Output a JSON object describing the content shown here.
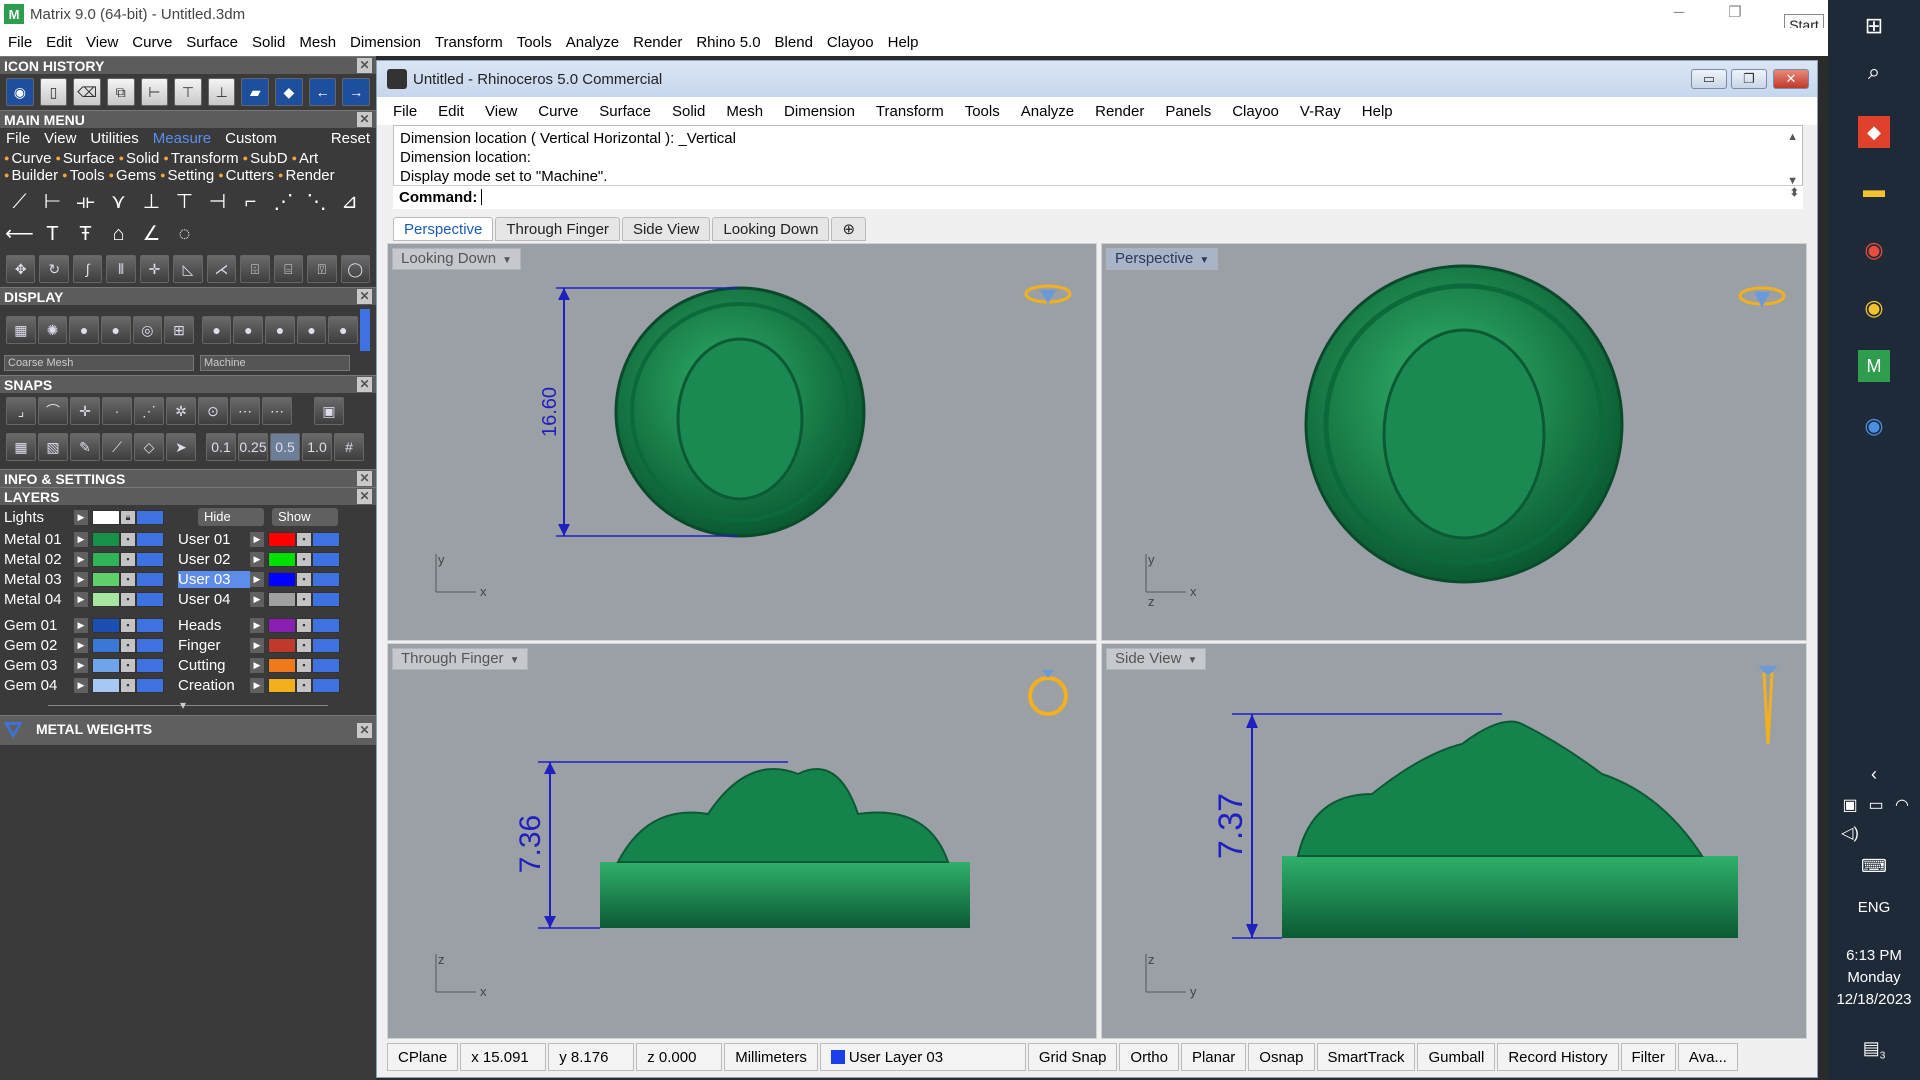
{
  "window": {
    "title": "Matrix 9.0 (64-bit) - Untitled.3dm",
    "start_tooltip": "Start"
  },
  "outer_menu": [
    "File",
    "Edit",
    "View",
    "Curve",
    "Surface",
    "Solid",
    "Mesh",
    "Dimension",
    "Transform",
    "Tools",
    "Analyze",
    "Render",
    "Rhino 5.0",
    "Blend",
    "Clayoo",
    "Help"
  ],
  "left": {
    "icon_history": "ICON HISTORY",
    "main_menu": "MAIN MENU",
    "mm_tabs": [
      "File",
      "View",
      "Utilities",
      "Measure",
      "Custom"
    ],
    "mm_reset": "Reset",
    "mm_cats": [
      "Curve",
      "Surface",
      "Solid",
      "Transform",
      "SubD",
      "Art",
      "Builder",
      "Tools",
      "Gems",
      "Setting",
      "Cutters",
      "Render"
    ],
    "display": "DISPLAY",
    "display_mesh": "Coarse Mesh",
    "display_mode": "Machine",
    "snaps": "SNAPS",
    "snap_values": [
      "0.1",
      "0.25",
      "0.5",
      "1.0"
    ],
    "info": "INFO & SETTINGS",
    "layers": "LAYERS",
    "lights": "Lights",
    "hide": "Hide",
    "show": "Show",
    "metal_weights": "METAL WEIGHTS",
    "layer_rows": [
      {
        "l": "Metal 01",
        "lc": "#17914a",
        "r": "User 01",
        "rc": "#ff0000"
      },
      {
        "l": "Metal 02",
        "lc": "#31b35a",
        "r": "User 02",
        "rc": "#00e000"
      },
      {
        "l": "Metal 03",
        "lc": "#5fd06c",
        "r": "User 03",
        "rc": "#0000ff"
      },
      {
        "l": "Metal 04",
        "lc": "#a6e6a0",
        "r": "User 04",
        "rc": "#a0a0a0"
      },
      {
        "l": "Gem 01",
        "lc": "#1c4fb4",
        "r": "Heads",
        "rc": "#8a1fb4"
      },
      {
        "l": "Gem 02",
        "lc": "#3a78d8",
        "r": "Finger",
        "rc": "#c0392b"
      },
      {
        "l": "Gem 03",
        "lc": "#6fa4ec",
        "r": "Cutting",
        "rc": "#f07a1a"
      },
      {
        "l": "Gem 04",
        "lc": "#a8c8f4",
        "r": "Creation",
        "rc": "#f2b11c"
      }
    ]
  },
  "rhino": {
    "title": "Untitled - Rhinoceros 5.0 Commercial",
    "menu": [
      "File",
      "Edit",
      "View",
      "Curve",
      "Surface",
      "Solid",
      "Mesh",
      "Dimension",
      "Transform",
      "Tools",
      "Analyze",
      "Render",
      "Panels",
      "Clayoo",
      "V-Ray",
      "Help"
    ],
    "history": [
      "Dimension location ( Vertical  Horizontal ): _Vertical",
      "Dimension location:",
      "Display mode set to \"Machine\"."
    ],
    "command_label": "Command:",
    "tabs": [
      "Perspective",
      "Through Finger",
      "Side View",
      "Looking Down"
    ],
    "viewports": {
      "looking_down": {
        "label": "Looking Down",
        "dim": "16.60",
        "ax1": "y",
        "ax2": "x"
      },
      "perspective": {
        "label": "Perspective",
        "ax1": "y",
        "ax2": "x",
        "ax3": "z"
      },
      "through_finger": {
        "label": "Through Finger",
        "dim": "7.36",
        "ax1": "z",
        "ax2": "x"
      },
      "side_view": {
        "label": "Side View",
        "dim": "7.37",
        "ax1": "z",
        "ax2": "y"
      }
    },
    "status": [
      "CPlane",
      "x 15.091",
      "y 8.176",
      "z 0.000",
      "Millimeters",
      "User Layer 03",
      "Grid Snap",
      "Ortho",
      "Planar",
      "Osnap",
      "SmartTrack",
      "Gumball",
      "Record History",
      "Filter",
      "Ava..."
    ],
    "layer_color": "#1a3ee8"
  },
  "taskbar": {
    "lang": "ENG",
    "time": "6:13 PM",
    "day": "Monday",
    "date": "12/18/2023",
    "notif": "3"
  }
}
